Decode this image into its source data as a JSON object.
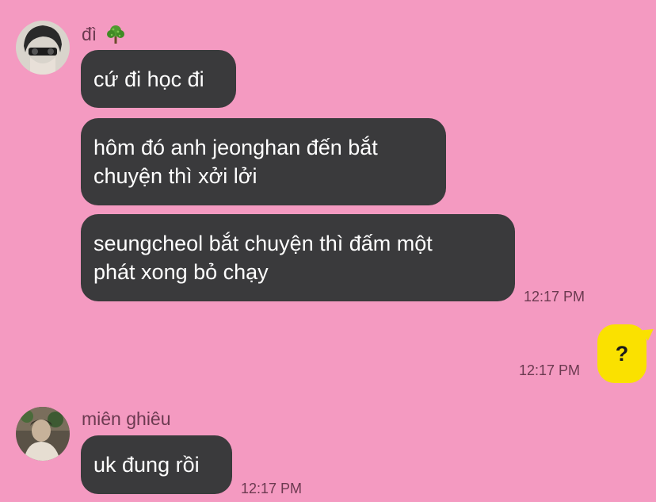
{
  "colors": {
    "background": "#F49AC1",
    "incoming_bubble": "#3A3A3C",
    "outgoing_bubble": "#FAE100",
    "meta_text": "#6B3A50"
  },
  "groups": [
    {
      "sender": "đì",
      "sender_icon": "bush-icon",
      "messages": [
        {
          "text": "cứ đi học đi"
        },
        {
          "text": "hôm đó anh jeonghan đến bắt\nchuyện thì xởi lởi"
        },
        {
          "text": "seungcheol bắt chuyện thì đấm một\nphát xong bỏ chạy",
          "time": "12:17 PM"
        }
      ]
    },
    {
      "sender": "me",
      "messages": [
        {
          "text": "?",
          "time": "12:17 PM"
        }
      ]
    },
    {
      "sender": "miên ghiêu",
      "messages": [
        {
          "text": "uk đung rồi",
          "time": "12:17 PM"
        }
      ]
    }
  ]
}
